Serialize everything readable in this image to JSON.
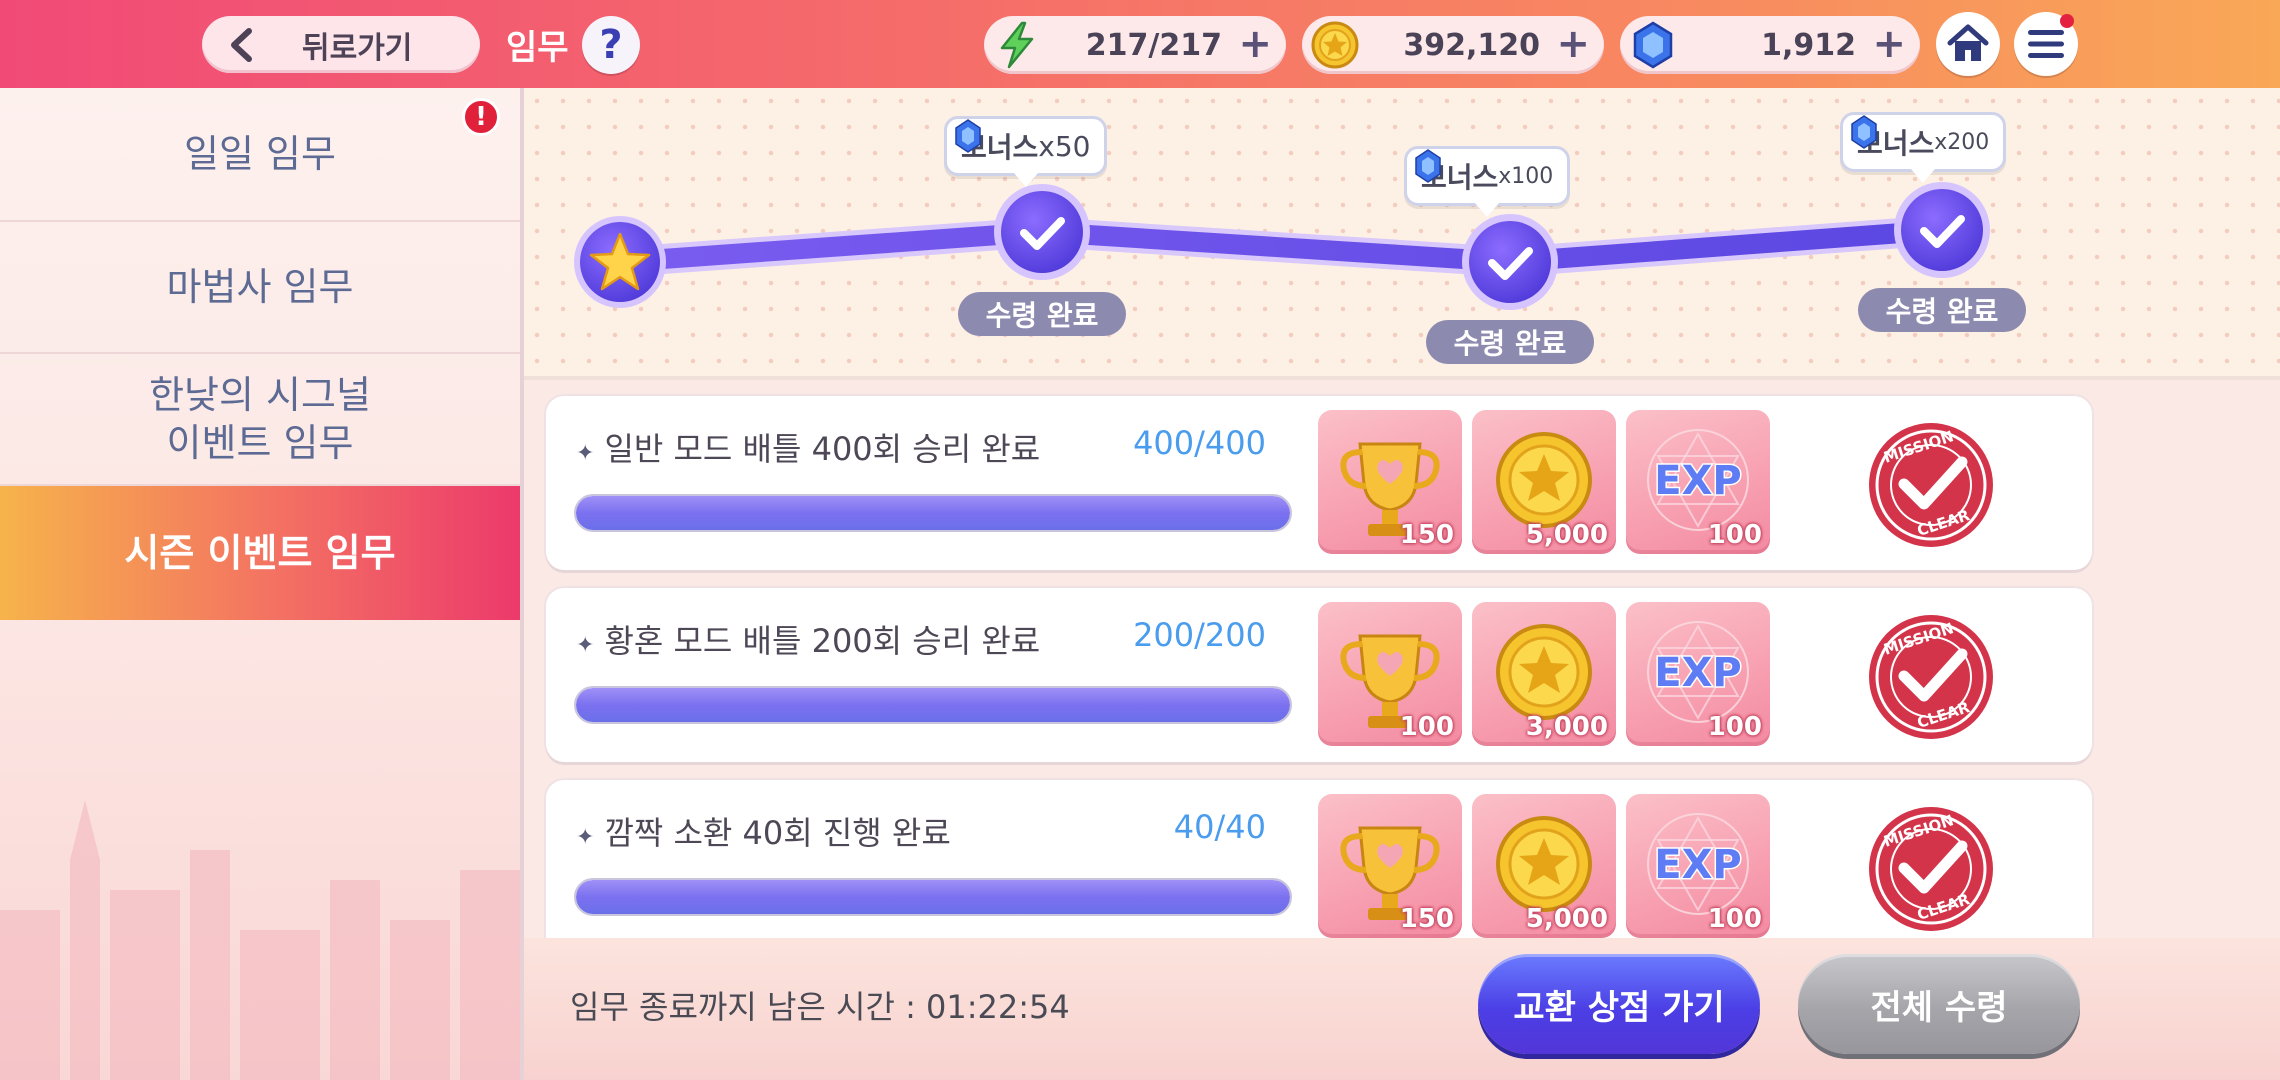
{
  "header": {
    "back_label": "뒤로가기",
    "title": "임무",
    "help_label": "?",
    "energy": "217/217",
    "gold": "392,120",
    "gems": "1,912",
    "plus": "+"
  },
  "sidebar": {
    "items": [
      {
        "label": "일일 임무",
        "alert": "!"
      },
      {
        "label": "마법사 임무"
      },
      {
        "label": "한낮의 시그널\n이벤트 임무"
      },
      {
        "label": "시즌 이벤트 임무"
      }
    ],
    "active_index": 3
  },
  "track": {
    "bonus_label": "보너스",
    "milestones": [
      {
        "multiplier": "x50",
        "status": "수령 완료"
      },
      {
        "multiplier": "x100",
        "status": "수령 완료"
      },
      {
        "multiplier": "x200",
        "status": "수령 완료"
      }
    ]
  },
  "missions": [
    {
      "title": "일반 모드 배틀 400회 승리 완료",
      "count": "400/400",
      "progress": 1.0,
      "rewards": [
        {
          "icon": "trophy-icon",
          "qty": "150"
        },
        {
          "icon": "gold-coin-icon",
          "qty": "5,000"
        },
        {
          "icon": "exp-icon",
          "qty": "100"
        }
      ],
      "stamp": "MISSION CLEAR"
    },
    {
      "title": "황혼 모드 배틀 200회 승리 완료",
      "count": "200/200",
      "progress": 1.0,
      "rewards": [
        {
          "icon": "trophy-icon",
          "qty": "100"
        },
        {
          "icon": "gold-coin-icon",
          "qty": "3,000"
        },
        {
          "icon": "exp-icon",
          "qty": "100"
        }
      ],
      "stamp": "MISSION CLEAR"
    },
    {
      "title": "깜짝 소환 40회 진행 완료",
      "count": "40/40",
      "progress": 1.0,
      "rewards": [
        {
          "icon": "trophy-icon",
          "qty": "150"
        },
        {
          "icon": "gold-coin-icon",
          "qty": "5,000"
        },
        {
          "icon": "exp-icon",
          "qty": "100"
        }
      ],
      "stamp": "MISSION CLEAR"
    }
  ],
  "exp_text": "EXP",
  "footer": {
    "timer": "임무 종료까지 남은 시간 : 01:22:54",
    "shop_button": "교환 상점 가기",
    "claim_all_button": "전체 수령"
  },
  "colors": {
    "accent": "#4b3fe5",
    "progress": "#7c71f0",
    "count": "#4a9cef",
    "stamp": "#d3344a"
  }
}
